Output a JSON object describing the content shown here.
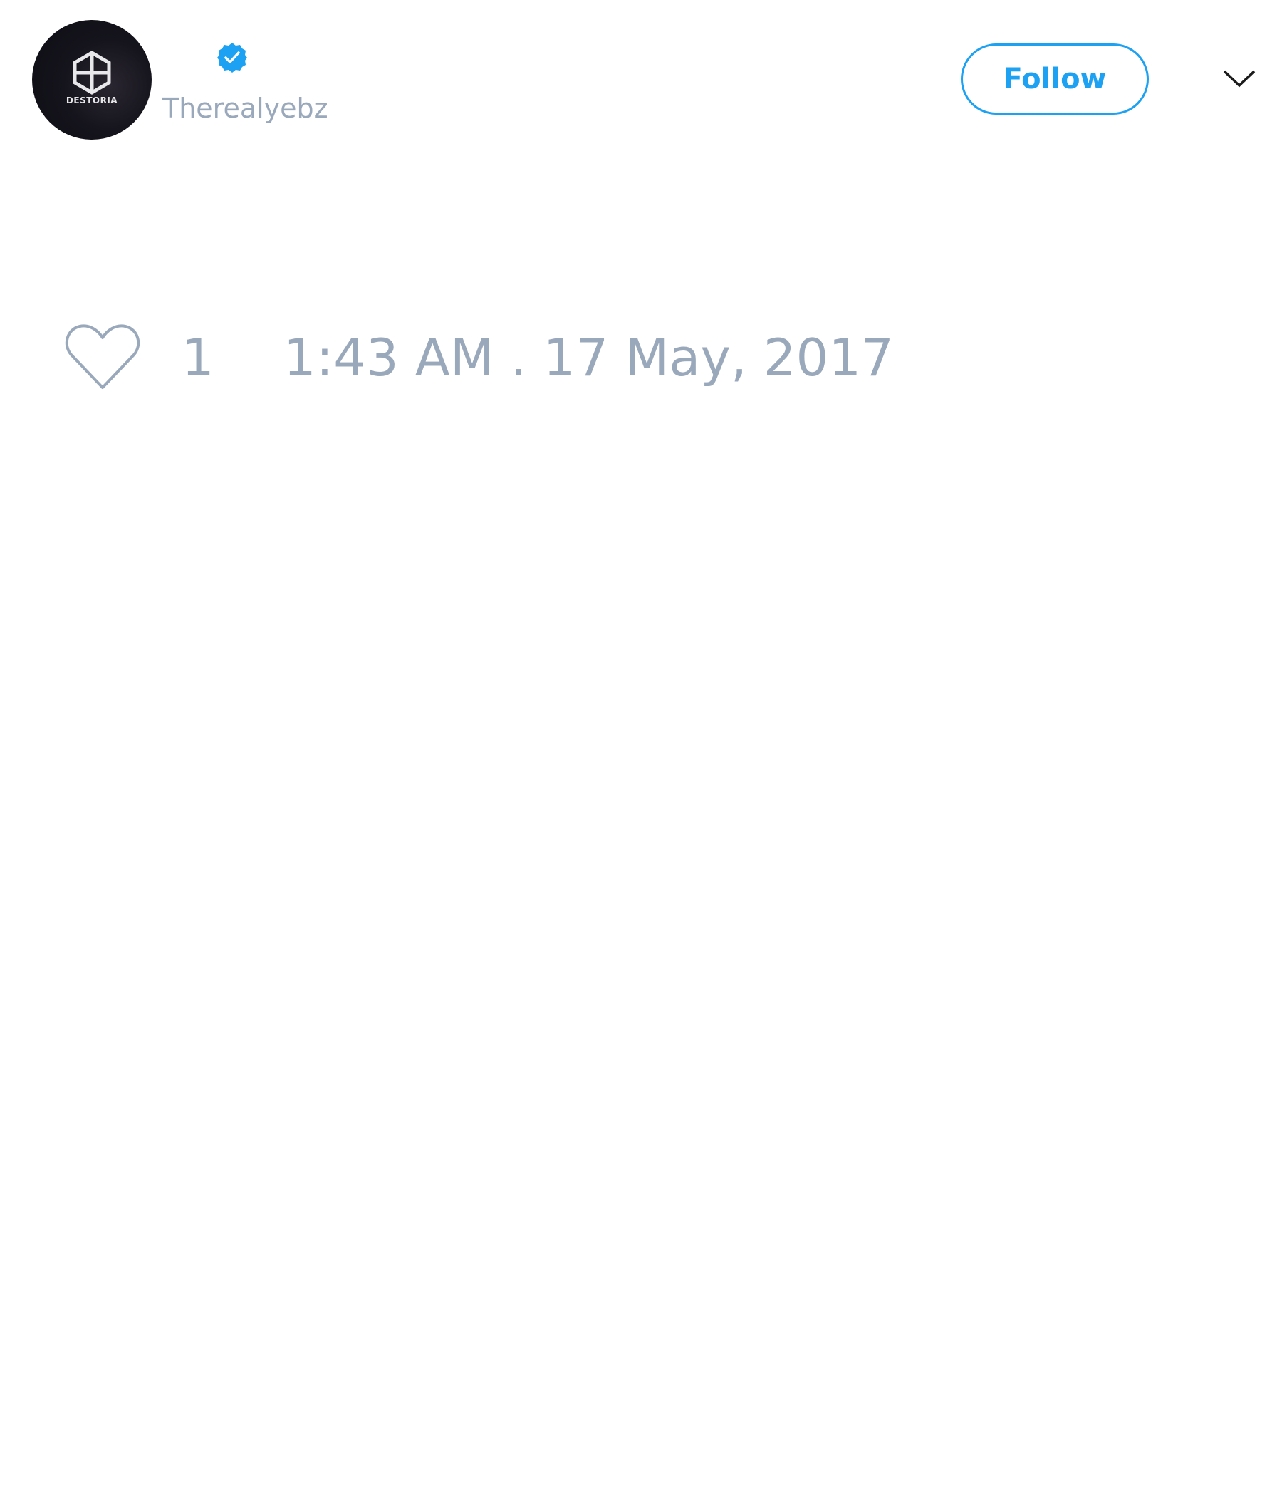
{
  "tweet": {
    "author": {
      "avatar_logo_text": "DESTORIA",
      "verified": true,
      "handle": "Therealyebz"
    },
    "follow_label": "Follow",
    "likes": "1",
    "timestamp": "1:43 AM . 17 May, 2017"
  },
  "icons": {
    "avatar": "avatar-image",
    "verified": "verified-badge-icon",
    "menu": "chevron-down-icon",
    "like": "heart-icon"
  },
  "colors": {
    "accent": "#1da1f2",
    "muted_text": "#9aa8bb",
    "background": "#ffffff"
  }
}
